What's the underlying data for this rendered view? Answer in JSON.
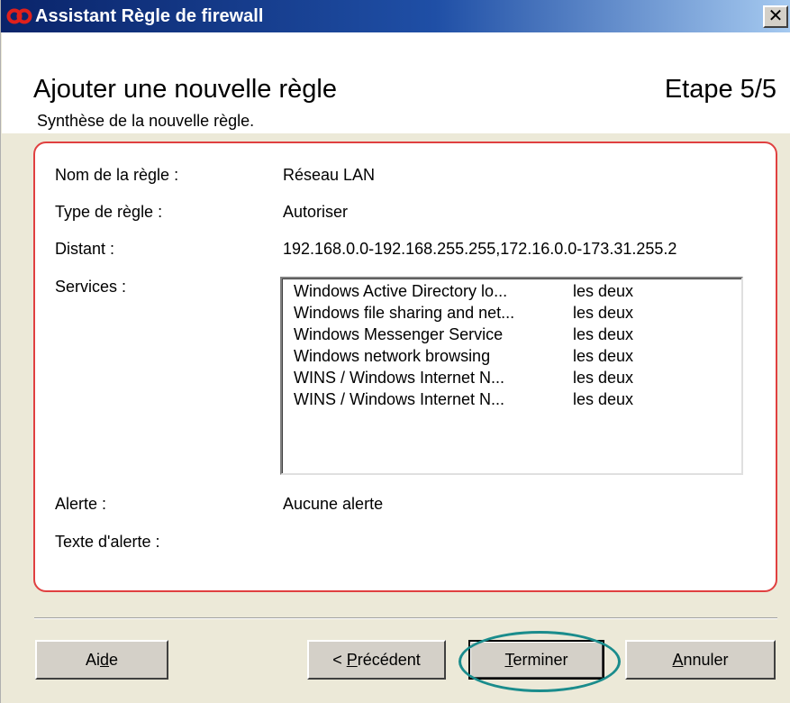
{
  "window": {
    "title": "Assistant Règle de firewall",
    "close_label": "✕"
  },
  "header": {
    "title": "Ajouter une nouvelle règle",
    "step": "Etape 5/5",
    "subtitle": "Synthèse de la nouvelle règle."
  },
  "summary": {
    "rule_name": {
      "label": "Nom de la règle :",
      "value": "Réseau LAN"
    },
    "rule_type": {
      "label": "Type de règle :",
      "value": "Autoriser"
    },
    "remote": {
      "label": "Distant :",
      "value": "192.168.0.0-192.168.255.255,172.16.0.0-173.31.255.2"
    },
    "services_label": "Services :",
    "services": [
      {
        "name": "Windows Active Directory lo...",
        "mode": "les deux"
      },
      {
        "name": "Windows file sharing and net...",
        "mode": "les deux"
      },
      {
        "name": "Windows Messenger Service",
        "mode": "les deux"
      },
      {
        "name": "Windows network browsing",
        "mode": "les deux"
      },
      {
        "name": "WINS / Windows Internet N...",
        "mode": "les deux"
      },
      {
        "name": "WINS / Windows Internet N...",
        "mode": "les deux"
      }
    ],
    "alert": {
      "label": "Alerte :",
      "value": "Aucune alerte"
    },
    "alert_text": {
      "label": "Texte d'alerte :",
      "value": ""
    }
  },
  "buttons": {
    "help": {
      "label": "Aide",
      "mnemonic_index": 2
    },
    "previous": {
      "label": "< Précédent",
      "mnemonic_index": 2
    },
    "finish": {
      "label": "Terminer",
      "mnemonic_index": 0
    },
    "cancel": {
      "label": "Annuler",
      "mnemonic_index": 0
    }
  },
  "colors": {
    "titlebar_start": "#0a246a",
    "titlebar_end": "#a6caf0",
    "panel_border": "#e04040",
    "highlight_ring": "#1a8c8c",
    "dialog_bg": "#ece9d8"
  }
}
